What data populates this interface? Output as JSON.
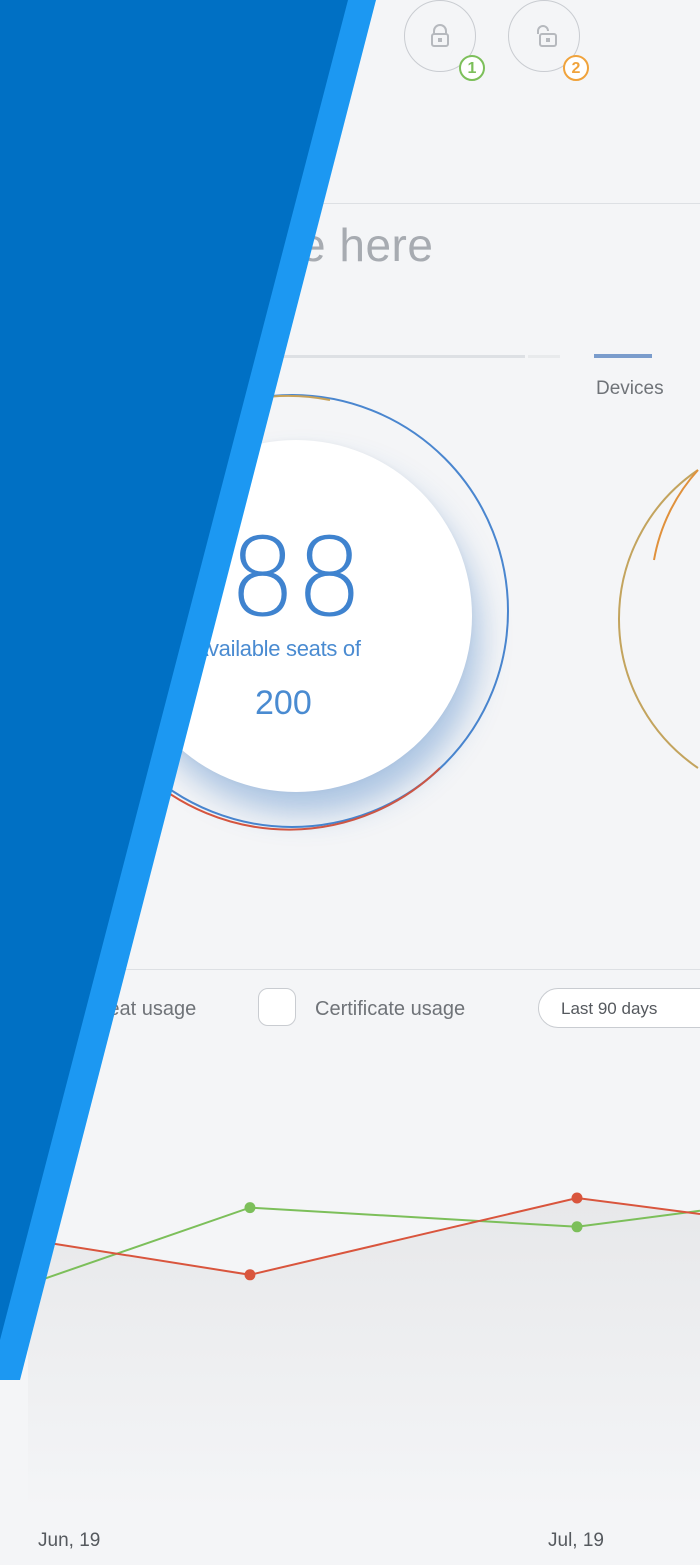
{
  "header": {
    "lock_badge": "1",
    "unlock_badge": "2"
  },
  "search": {
    "text": "e here"
  },
  "tabs": {
    "devices": "Devices"
  },
  "seats": {
    "available": "88",
    "label": "Available seats of",
    "total": "200"
  },
  "filters": {
    "seat_usage": "Seat usage",
    "certificate_usage": "Certificate usage",
    "range": "Last 90 days"
  },
  "chart_data": {
    "type": "line",
    "x": [
      "Jun, 19",
      "Jul, 19"
    ],
    "series": [
      {
        "color": "#7cbf5a",
        "values": [
          0.58,
          0.82,
          0.76,
          0.81
        ]
      },
      {
        "color": "#d9553d",
        "values": [
          0.72,
          0.61,
          0.85,
          0.8
        ]
      }
    ],
    "colors": {
      "green": "#7cbf5a",
      "red": "#d9553d"
    }
  },
  "colors": {
    "accent": "#3f83cf",
    "banner_dark": "#0070c4",
    "banner_light": "#1c98f2",
    "badge_green": "#7cbf5a",
    "badge_orange": "#f0a33c"
  }
}
